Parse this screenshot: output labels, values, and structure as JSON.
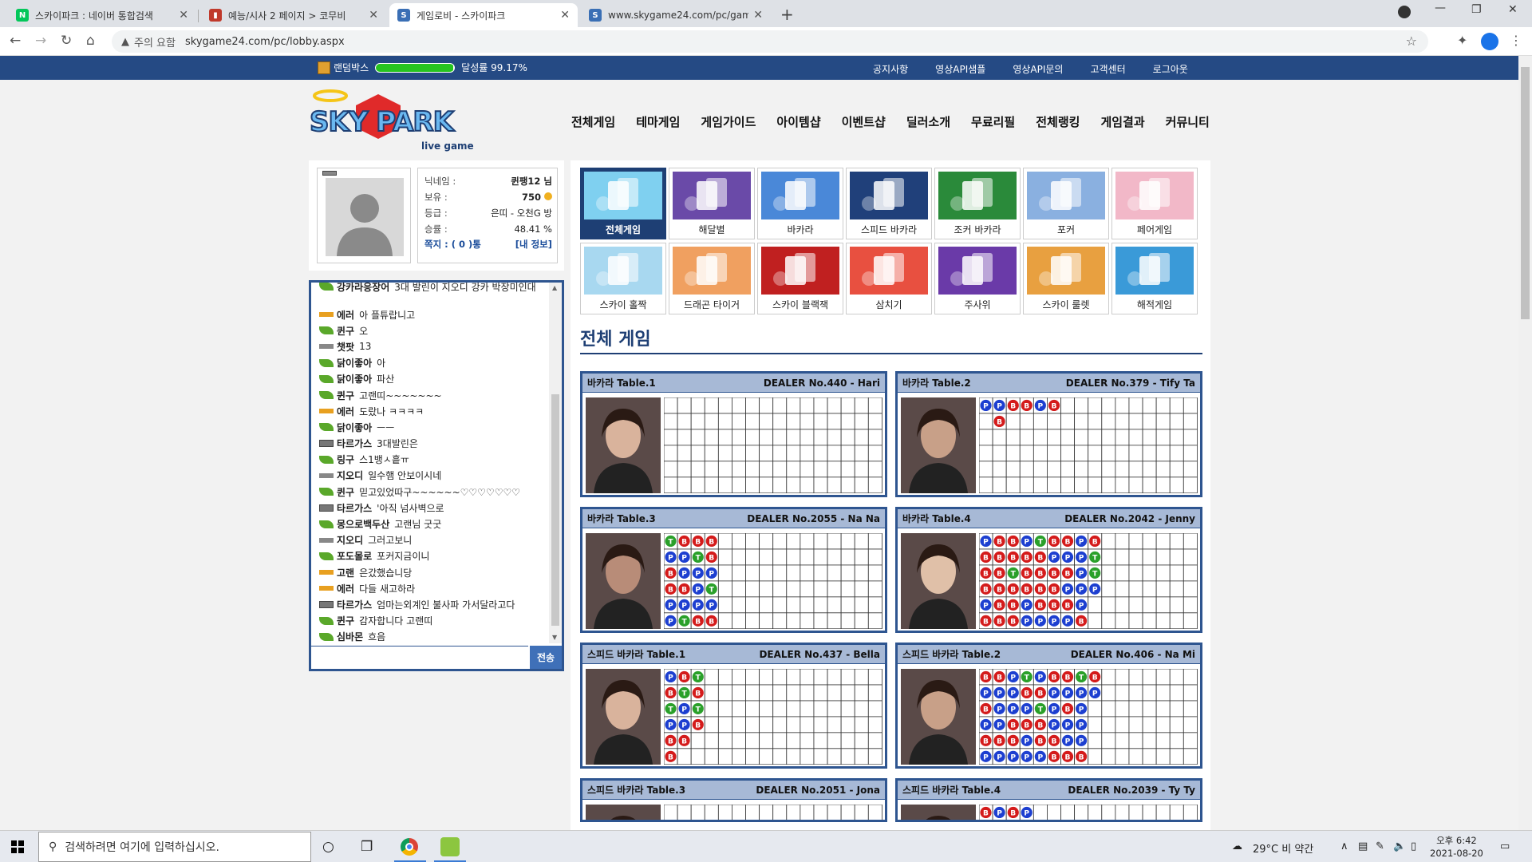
{
  "browser": {
    "tabs": [
      {
        "title": "스카이파크 : 네이버 통합검색",
        "favicon": "N",
        "color": "#03c75a"
      },
      {
        "title": "예능/시사 2 페이지 > 코무비",
        "favicon": "▮",
        "color": "#c0392b"
      },
      {
        "title": "게임로비 - 스카이파크",
        "favicon": "S",
        "color": "#3a6fb5"
      },
      {
        "title": "www.skygame24.com/pc/game/",
        "favicon": "S",
        "color": "#3a6fb5"
      }
    ],
    "security_label": "주의 요함",
    "url": "skygame24.com/pc/lobby.aspx"
  },
  "topbar": {
    "random_box_label": "랜덤박스",
    "achievement_label": "달성률 99.17%",
    "achievement_percent": 99.17,
    "links": [
      "공지사항",
      "영상API샘플",
      "영상API문의",
      "고객센터",
      "로그아웃"
    ]
  },
  "logo": {
    "text": "SKY PARK",
    "sub": "live games"
  },
  "main_nav": [
    "전체게임",
    "테마게임",
    "게임가이드",
    "아이템샵",
    "이벤트샵",
    "딜러소개",
    "무료리필",
    "전체랭킹",
    "게임결과",
    "커뮤니티"
  ],
  "profile": {
    "rows": [
      {
        "k": "닉네임 :",
        "v": "퀸팽12 님"
      },
      {
        "k": "보유 :",
        "v": "750"
      },
      {
        "k": "등급 :",
        "v": "은띠 - 오천G 방"
      },
      {
        "k": "승률 :",
        "v": "48.41 %"
      }
    ],
    "message": "쪽지 : ( 0 )통",
    "myinfo": "[내 정보]"
  },
  "chat": {
    "messages": [
      {
        "lv": "leaf",
        "name": "강카라응장어",
        "text": "3대 발린이 지오디 강카 박장미인대"
      },
      {
        "lv": "gold",
        "name": "에러",
        "text": "아 플튜랍니고"
      },
      {
        "lv": "leaf",
        "name": "퀸구",
        "text": "오"
      },
      {
        "lv": "gray",
        "name": "챗팟",
        "text": "13"
      },
      {
        "lv": "leaf",
        "name": "닭이좋아",
        "text": "아"
      },
      {
        "lv": "leaf",
        "name": "닭이좋아",
        "text": "파산"
      },
      {
        "lv": "leaf",
        "name": "퀸구",
        "text": "고랜띠~~~~~~~"
      },
      {
        "lv": "gold",
        "name": "에러",
        "text": "도랐나 ㅋㅋㅋㅋ"
      },
      {
        "lv": "leaf",
        "name": "닭이좋아",
        "text": "ㅡㅡ"
      },
      {
        "lv": "grid",
        "name": "타르가스",
        "text": "3대발린은"
      },
      {
        "lv": "leaf",
        "name": "링구",
        "text": "스1뱅ㅅ흩ㅠ"
      },
      {
        "lv": "gray",
        "name": "지오디",
        "text": "일수햄 안보이시네"
      },
      {
        "lv": "leaf",
        "name": "퀸구",
        "text": "믿고있었따구~~~~~~♡♡♡♡♡♡♡"
      },
      {
        "lv": "grid",
        "name": "타르가스",
        "text": "'아직 넘사벽으로"
      },
      {
        "lv": "leaf",
        "name": "몽으로백두산",
        "text": "고랜님 굿굿"
      },
      {
        "lv": "gray",
        "name": "지오디",
        "text": "그러고보니"
      },
      {
        "lv": "leaf",
        "name": "포도몰로",
        "text": "포커지금이니"
      },
      {
        "lv": "gold",
        "name": "고랜",
        "text": "은갔했습니당"
      },
      {
        "lv": "gold",
        "name": "에러",
        "text": "다들 새고하라"
      },
      {
        "lv": "grid",
        "name": "타르가스",
        "text": "엄마는외계인 불사파 가서달라고다"
      },
      {
        "lv": "leaf",
        "name": "퀸구",
        "text": "감자합니다 고랜띠"
      },
      {
        "lv": "leaf",
        "name": "심바몬",
        "text": "흐음"
      }
    ],
    "send_label": "전송"
  },
  "games": [
    {
      "label": "전체게임",
      "active": true,
      "icon": "all-games-icon",
      "bg": "#7fd0f0"
    },
    {
      "label": "해달별",
      "icon": "sun-moon-star-icon",
      "bg": "#6a4aa8"
    },
    {
      "label": "바카라",
      "icon": "baccarat-icon",
      "bg": "#4a88d8"
    },
    {
      "label": "스피드 바카라",
      "icon": "speed-baccarat-icon",
      "bg": "#20407a"
    },
    {
      "label": "조커 바카라",
      "icon": "joker-baccarat-icon",
      "bg": "#2a8a3a"
    },
    {
      "label": "포커",
      "icon": "poker-icon",
      "bg": "#8ab0e0"
    },
    {
      "label": "페어게임",
      "icon": "pair-game-icon",
      "bg": "#f2b8c8"
    },
    {
      "label": "스카이 홀짝",
      "icon": "odd-even-icon",
      "bg": "#a8d8f0"
    },
    {
      "label": "드래곤 타이거",
      "icon": "dragon-tiger-icon",
      "bg": "#f0a060"
    },
    {
      "label": "스카이 블랙잭",
      "icon": "blackjack-icon",
      "bg": "#c02020"
    },
    {
      "label": "삼치기",
      "icon": "samchigi-icon",
      "bg": "#e85040"
    },
    {
      "label": "주사위",
      "icon": "dice-icon",
      "bg": "#6a3aa8"
    },
    {
      "label": "스카이 룰렛",
      "icon": "roulette-icon",
      "bg": "#e8a040"
    },
    {
      "label": "해적게임",
      "icon": "pirate-icon",
      "bg": "#3a9ad8"
    }
  ],
  "section_title": "전체 게임",
  "tables": [
    {
      "name": "바카라 Table.1",
      "dealer": "DEALER No.440 - Hari",
      "cols": []
    },
    {
      "name": "바카라 Table.2",
      "dealer": "DEALER No.379 - Tify Ta",
      "cols": [
        "P",
        "PB",
        "B",
        "B",
        "P",
        "B"
      ]
    },
    {
      "name": "바카라 Table.3",
      "dealer": "DEALER No.2055 - Na Na",
      "cols": [
        "TPBBPP",
        "BPPBPT",
        "BTPPPB",
        "BBPTPB"
      ]
    },
    {
      "name": "바카라 Table.4",
      "dealer": "DEALER No.2042 - Jenny",
      "cols": [
        "PBBBPB",
        "BBBBBB",
        "BBTBBB",
        "PBBBPP",
        "TBBBBP",
        "BPBBBP",
        "BPBPBP",
        "PPPPPB",
        "BTTP"
      ]
    },
    {
      "name": "스피드 바카라 Table.1",
      "dealer": "DEALER No.437 - Bella",
      "cols": [
        "PBTPBB",
        "BTPPB",
        "TBTB"
      ]
    },
    {
      "name": "스피드 바카라 Table.2",
      "dealer": "DEALER No.406 - Na Mi",
      "cols": [
        "BPBPBP",
        "BPPPBP",
        "PPPBBP",
        "TBPBPP",
        "PBTBBP",
        "BPPPBB",
        "BPBPPB",
        "TPPPPB",
        "BP"
      ]
    },
    {
      "name": "스피드 바카라 Table.3",
      "dealer": "DEALER No.2051 - Jona",
      "cols": []
    },
    {
      "name": "스피드 바카라 Table.4",
      "dealer": "DEALER No.2039 - Ty Ty",
      "cols": [
        "BP",
        "P",
        "BT",
        "P"
      ]
    }
  ],
  "taskbar": {
    "search_placeholder": "검색하려면 여기에 입력하십시오.",
    "weather": "29°C  비 약간",
    "time": "오후 6:42",
    "date": "2021-08-20"
  }
}
